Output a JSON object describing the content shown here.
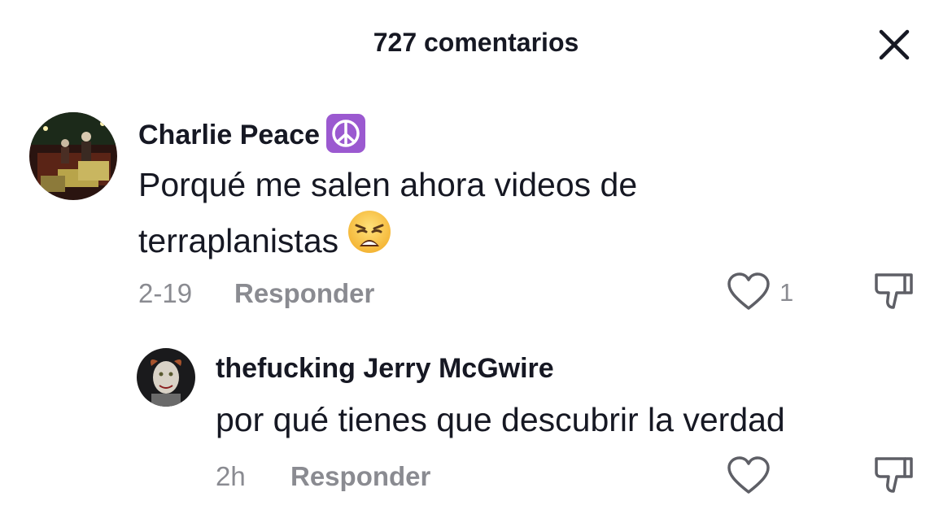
{
  "header": {
    "title": "727 comentarios",
    "close_icon": "close-icon"
  },
  "comments": [
    {
      "username": "Charlie Peace",
      "username_emoji": "peace-symbol-icon",
      "text_line1": "Porqué me salen ahora videos de",
      "text_line2": "terraplanistas",
      "text_emoji": "weary-face-emoji",
      "time": "2-19",
      "reply_label": "Responder",
      "like_count": "1"
    }
  ],
  "replies": [
    {
      "username": "thefucking Jerry McGwire",
      "text": "por qué tienes que descubrir la verdad",
      "time": "2h",
      "reply_label": "Responder"
    }
  ],
  "colors": {
    "text": "#161823",
    "muted": "#8a8b91",
    "peace_bg": "#9b59d0"
  }
}
